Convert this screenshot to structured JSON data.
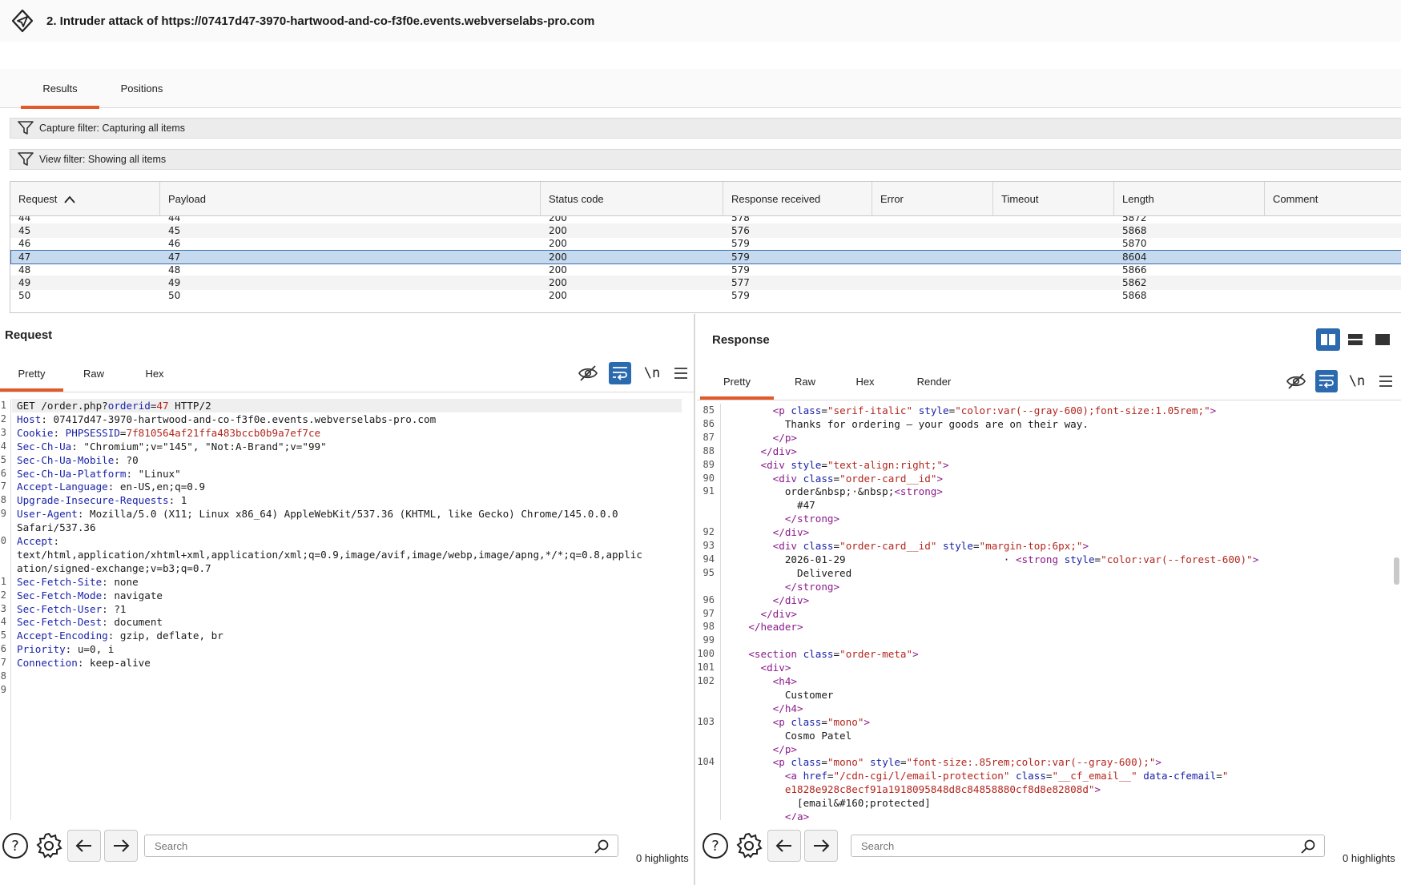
{
  "window": {
    "title": "2. Intruder attack of https://07417d47-3970-hartwood-and-co-f3f0e.events.webverselabs-pro.com"
  },
  "tabs": [
    {
      "label": "Results",
      "active": true
    },
    {
      "label": "Positions",
      "active": false
    }
  ],
  "filters": {
    "capture": "Capture filter: Capturing all items",
    "view": "View filter: Showing all items"
  },
  "results_table": {
    "columns": [
      "Request",
      "Payload",
      "Status code",
      "Response received",
      "Error",
      "Timeout",
      "Length",
      "Comment"
    ],
    "sort_column": "Request",
    "sort_direction": "ascending",
    "rows": [
      {
        "request": "44",
        "payload": "44",
        "status": "200",
        "received": "578",
        "error": "",
        "timeout": "",
        "length": "5872",
        "comment": "",
        "selected": false
      },
      {
        "request": "45",
        "payload": "45",
        "status": "200",
        "received": "576",
        "error": "",
        "timeout": "",
        "length": "5868",
        "comment": "",
        "selected": false
      },
      {
        "request": "46",
        "payload": "46",
        "status": "200",
        "received": "579",
        "error": "",
        "timeout": "",
        "length": "5870",
        "comment": "",
        "selected": false
      },
      {
        "request": "47",
        "payload": "47",
        "status": "200",
        "received": "579",
        "error": "",
        "timeout": "",
        "length": "8604",
        "comment": "",
        "selected": true
      },
      {
        "request": "48",
        "payload": "48",
        "status": "200",
        "received": "579",
        "error": "",
        "timeout": "",
        "length": "5866",
        "comment": "",
        "selected": false
      },
      {
        "request": "49",
        "payload": "49",
        "status": "200",
        "received": "577",
        "error": "",
        "timeout": "",
        "length": "5862",
        "comment": "",
        "selected": false
      },
      {
        "request": "50",
        "payload": "50",
        "status": "200",
        "received": "579",
        "error": "",
        "timeout": "",
        "length": "5868",
        "comment": "",
        "selected": false
      }
    ]
  },
  "request_panel": {
    "title": "Request",
    "tabs": [
      "Pretty",
      "Raw",
      "Hex"
    ],
    "active_tab": "Pretty",
    "lines": [
      {
        "n": "1",
        "parts": [
          [
            "",
            "GET /order.php?"
          ],
          [
            "k",
            "orderid"
          ],
          [
            "",
            "="
          ],
          [
            "v",
            "47"
          ],
          [
            "",
            " HTTP/2"
          ]
        ]
      },
      {
        "n": "2",
        "parts": [
          [
            "k",
            "Host"
          ],
          [
            "",
            ": 07417d47-3970-hartwood-and-co-f3f0e.events.webverselabs-pro.com"
          ]
        ]
      },
      {
        "n": "3",
        "parts": [
          [
            "k",
            "Cookie"
          ],
          [
            "",
            ": "
          ],
          [
            "k",
            "PHPSESSID"
          ],
          [
            "",
            "="
          ],
          [
            "v",
            "7f810564af21ffa483bccb0b9a7ef7ce"
          ]
        ]
      },
      {
        "n": "4",
        "parts": [
          [
            "k",
            "Sec-Ch-Ua"
          ],
          [
            "",
            ": \"Chromium\";v=\"145\", \"Not:A-Brand\";v=\"99\""
          ]
        ]
      },
      {
        "n": "5",
        "parts": [
          [
            "k",
            "Sec-Ch-Ua-Mobile"
          ],
          [
            "",
            ": ?0"
          ]
        ]
      },
      {
        "n": "6",
        "parts": [
          [
            "k",
            "Sec-Ch-Ua-Platform"
          ],
          [
            "",
            ": \"Linux\""
          ]
        ]
      },
      {
        "n": "7",
        "parts": [
          [
            "k",
            "Accept-Language"
          ],
          [
            "",
            ": en-US,en;q=0.9"
          ]
        ]
      },
      {
        "n": "8",
        "parts": [
          [
            "k",
            "Upgrade-Insecure-Requests"
          ],
          [
            "",
            ": 1"
          ]
        ]
      },
      {
        "n": "9",
        "parts": [
          [
            "k",
            "User-Agent"
          ],
          [
            "",
            ": Mozilla/5.0 (X11; Linux x86_64) AppleWebKit/537.36 (KHTML, like Gecko) Chrome/145.0.0.0"
          ]
        ]
      },
      {
        "n": "",
        "parts": [
          [
            "",
            "Safari/537.36"
          ]
        ]
      },
      {
        "n": "0",
        "parts": [
          [
            "k",
            "Accept"
          ],
          [
            "",
            ":"
          ]
        ]
      },
      {
        "n": "",
        "parts": [
          [
            "",
            "text/html,application/xhtml+xml,application/xml;q=0.9,image/avif,image/webp,image/apng,*/*;q=0.8,applic"
          ]
        ]
      },
      {
        "n": "",
        "parts": [
          [
            "",
            "ation/signed-exchange;v=b3;q=0.7"
          ]
        ]
      },
      {
        "n": "1",
        "parts": [
          [
            "k",
            "Sec-Fetch-Site"
          ],
          [
            "",
            ": none"
          ]
        ]
      },
      {
        "n": "2",
        "parts": [
          [
            "k",
            "Sec-Fetch-Mode"
          ],
          [
            "",
            ": navigate"
          ]
        ]
      },
      {
        "n": "3",
        "parts": [
          [
            "k",
            "Sec-Fetch-User"
          ],
          [
            "",
            ": ?1"
          ]
        ]
      },
      {
        "n": "4",
        "parts": [
          [
            "k",
            "Sec-Fetch-Dest"
          ],
          [
            "",
            ": document"
          ]
        ]
      },
      {
        "n": "5",
        "parts": [
          [
            "k",
            "Accept-Encoding"
          ],
          [
            "",
            ": gzip, deflate, br"
          ]
        ]
      },
      {
        "n": "6",
        "parts": [
          [
            "k",
            "Priority"
          ],
          [
            "",
            ": u=0, i"
          ]
        ]
      },
      {
        "n": "7",
        "parts": [
          [
            "k",
            "Connection"
          ],
          [
            "",
            ": keep-alive"
          ]
        ]
      },
      {
        "n": "8",
        "parts": [
          [
            "",
            ""
          ]
        ]
      },
      {
        "n": "9",
        "parts": [
          [
            "",
            ""
          ]
        ]
      }
    ],
    "search_placeholder": "Search",
    "highlights": "0 highlights"
  },
  "response_panel": {
    "title": "Response",
    "tabs": [
      "Pretty",
      "Raw",
      "Hex",
      "Render"
    ],
    "active_tab": "Pretty",
    "lines": [
      {
        "n": "85",
        "parts": [
          [
            "",
            "        "
          ],
          [
            "t",
            "<p "
          ],
          [
            "a",
            "class"
          ],
          [
            "",
            "="
          ],
          [
            "s",
            "\"serif-italic\""
          ],
          [
            "",
            " "
          ],
          [
            "a",
            "style"
          ],
          [
            "",
            "="
          ],
          [
            "s",
            "\"color:var(--gray-600);font-size:1.05rem;\""
          ],
          [
            "t",
            ">"
          ]
        ]
      },
      {
        "n": "86",
        "parts": [
          [
            "",
            "          Thanks for ordering — your goods are on their way."
          ]
        ]
      },
      {
        "n": "87",
        "parts": [
          [
            "",
            "        "
          ],
          [
            "t",
            "</p>"
          ]
        ]
      },
      {
        "n": "88",
        "parts": [
          [
            "",
            "      "
          ],
          [
            "t",
            "</div>"
          ]
        ]
      },
      {
        "n": "89",
        "parts": [
          [
            "",
            "      "
          ],
          [
            "t",
            "<div "
          ],
          [
            "a",
            "style"
          ],
          [
            "",
            "="
          ],
          [
            "s",
            "\"text-align:right;\""
          ],
          [
            "t",
            ">"
          ]
        ]
      },
      {
        "n": "90",
        "parts": [
          [
            "",
            "        "
          ],
          [
            "t",
            "<div "
          ],
          [
            "a",
            "class"
          ],
          [
            "",
            "="
          ],
          [
            "s",
            "\"order-card__id\""
          ],
          [
            "t",
            ">"
          ]
        ]
      },
      {
        "n": "91",
        "parts": [
          [
            "",
            "          order&nbsp;·&nbsp;"
          ],
          [
            "t",
            "<strong>"
          ]
        ]
      },
      {
        "n": "",
        "parts": [
          [
            "",
            "            #47"
          ]
        ]
      },
      {
        "n": "",
        "parts": [
          [
            "",
            "          "
          ],
          [
            "t",
            "</strong>"
          ]
        ]
      },
      {
        "n": "92",
        "parts": [
          [
            "",
            "        "
          ],
          [
            "t",
            "</div>"
          ]
        ]
      },
      {
        "n": "93",
        "parts": [
          [
            "",
            "        "
          ],
          [
            "t",
            "<div "
          ],
          [
            "a",
            "class"
          ],
          [
            "",
            "="
          ],
          [
            "s",
            "\"order-card__id\""
          ],
          [
            "",
            " "
          ],
          [
            "a",
            "style"
          ],
          [
            "",
            "="
          ],
          [
            "s",
            "\"margin-top:6px;\""
          ],
          [
            "t",
            ">"
          ]
        ]
      },
      {
        "n": "94",
        "parts": [
          [
            "",
            "          2026-01-29                          · "
          ],
          [
            "t",
            "<strong "
          ],
          [
            "a",
            "style"
          ],
          [
            "",
            "="
          ],
          [
            "s",
            "\"color:var(--forest-600)\""
          ],
          [
            "t",
            ">"
          ]
        ]
      },
      {
        "n": "95",
        "parts": [
          [
            "",
            "            Delivered"
          ]
        ]
      },
      {
        "n": "",
        "parts": [
          [
            "",
            "          "
          ],
          [
            "t",
            "</strong>"
          ]
        ]
      },
      {
        "n": "96",
        "parts": [
          [
            "",
            "        "
          ],
          [
            "t",
            "</div>"
          ]
        ]
      },
      {
        "n": "97",
        "parts": [
          [
            "",
            "      "
          ],
          [
            "t",
            "</div>"
          ]
        ]
      },
      {
        "n": "98",
        "parts": [
          [
            "",
            "    "
          ],
          [
            "t",
            "</header>"
          ]
        ]
      },
      {
        "n": "99",
        "parts": [
          [
            "",
            ""
          ]
        ]
      },
      {
        "n": "100",
        "parts": [
          [
            "",
            "    "
          ],
          [
            "t",
            "<section "
          ],
          [
            "a",
            "class"
          ],
          [
            "",
            "="
          ],
          [
            "s",
            "\"order-meta\""
          ],
          [
            "t",
            ">"
          ]
        ]
      },
      {
        "n": "101",
        "parts": [
          [
            "",
            "      "
          ],
          [
            "t",
            "<div>"
          ]
        ]
      },
      {
        "n": "102",
        "parts": [
          [
            "",
            "        "
          ],
          [
            "t",
            "<h4>"
          ]
        ]
      },
      {
        "n": "",
        "parts": [
          [
            "",
            "          Customer"
          ]
        ]
      },
      {
        "n": "",
        "parts": [
          [
            "",
            "        "
          ],
          [
            "t",
            "</h4>"
          ]
        ]
      },
      {
        "n": "103",
        "parts": [
          [
            "",
            "        "
          ],
          [
            "t",
            "<p "
          ],
          [
            "a",
            "class"
          ],
          [
            "",
            "="
          ],
          [
            "s",
            "\"mono\""
          ],
          [
            "t",
            ">"
          ]
        ]
      },
      {
        "n": "",
        "parts": [
          [
            "",
            "          Cosmo Patel"
          ]
        ]
      },
      {
        "n": "",
        "parts": [
          [
            "",
            "        "
          ],
          [
            "t",
            "</p>"
          ]
        ]
      },
      {
        "n": "104",
        "parts": [
          [
            "",
            "        "
          ],
          [
            "t",
            "<p "
          ],
          [
            "a",
            "class"
          ],
          [
            "",
            "="
          ],
          [
            "s",
            "\"mono\""
          ],
          [
            "",
            " "
          ],
          [
            "a",
            "style"
          ],
          [
            "",
            "="
          ],
          [
            "s",
            "\"font-size:.85rem;color:var(--gray-600);\""
          ],
          [
            "t",
            ">"
          ]
        ]
      },
      {
        "n": "",
        "parts": [
          [
            "",
            "          "
          ],
          [
            "t",
            "<a "
          ],
          [
            "a",
            "href"
          ],
          [
            "",
            "="
          ],
          [
            "s",
            "\"/cdn-cgi/l/email-protection\""
          ],
          [
            "",
            " "
          ],
          [
            "a",
            "class"
          ],
          [
            "",
            "="
          ],
          [
            "s",
            "\"__cf_email__\""
          ],
          [
            "",
            " "
          ],
          [
            "a",
            "data-cfemail"
          ],
          [
            "",
            "="
          ],
          [
            "s",
            "\""
          ]
        ]
      },
      {
        "n": "",
        "parts": [
          [
            "",
            "          "
          ],
          [
            "s",
            "e1828e928c8ecf91a1918095848d8c84858880cf8d8e82808d\""
          ],
          [
            "t",
            ">"
          ]
        ]
      },
      {
        "n": "",
        "parts": [
          [
            "",
            "            [email&#160;protected]"
          ]
        ]
      },
      {
        "n": "",
        "parts": [
          [
            "",
            "          "
          ],
          [
            "t",
            "</a>"
          ]
        ]
      },
      {
        "n": "",
        "parts": [
          [
            "",
            "        "
          ],
          [
            "t",
            "</p>"
          ]
        ]
      }
    ],
    "search_placeholder": "Search",
    "highlights": "0 highlights"
  }
}
